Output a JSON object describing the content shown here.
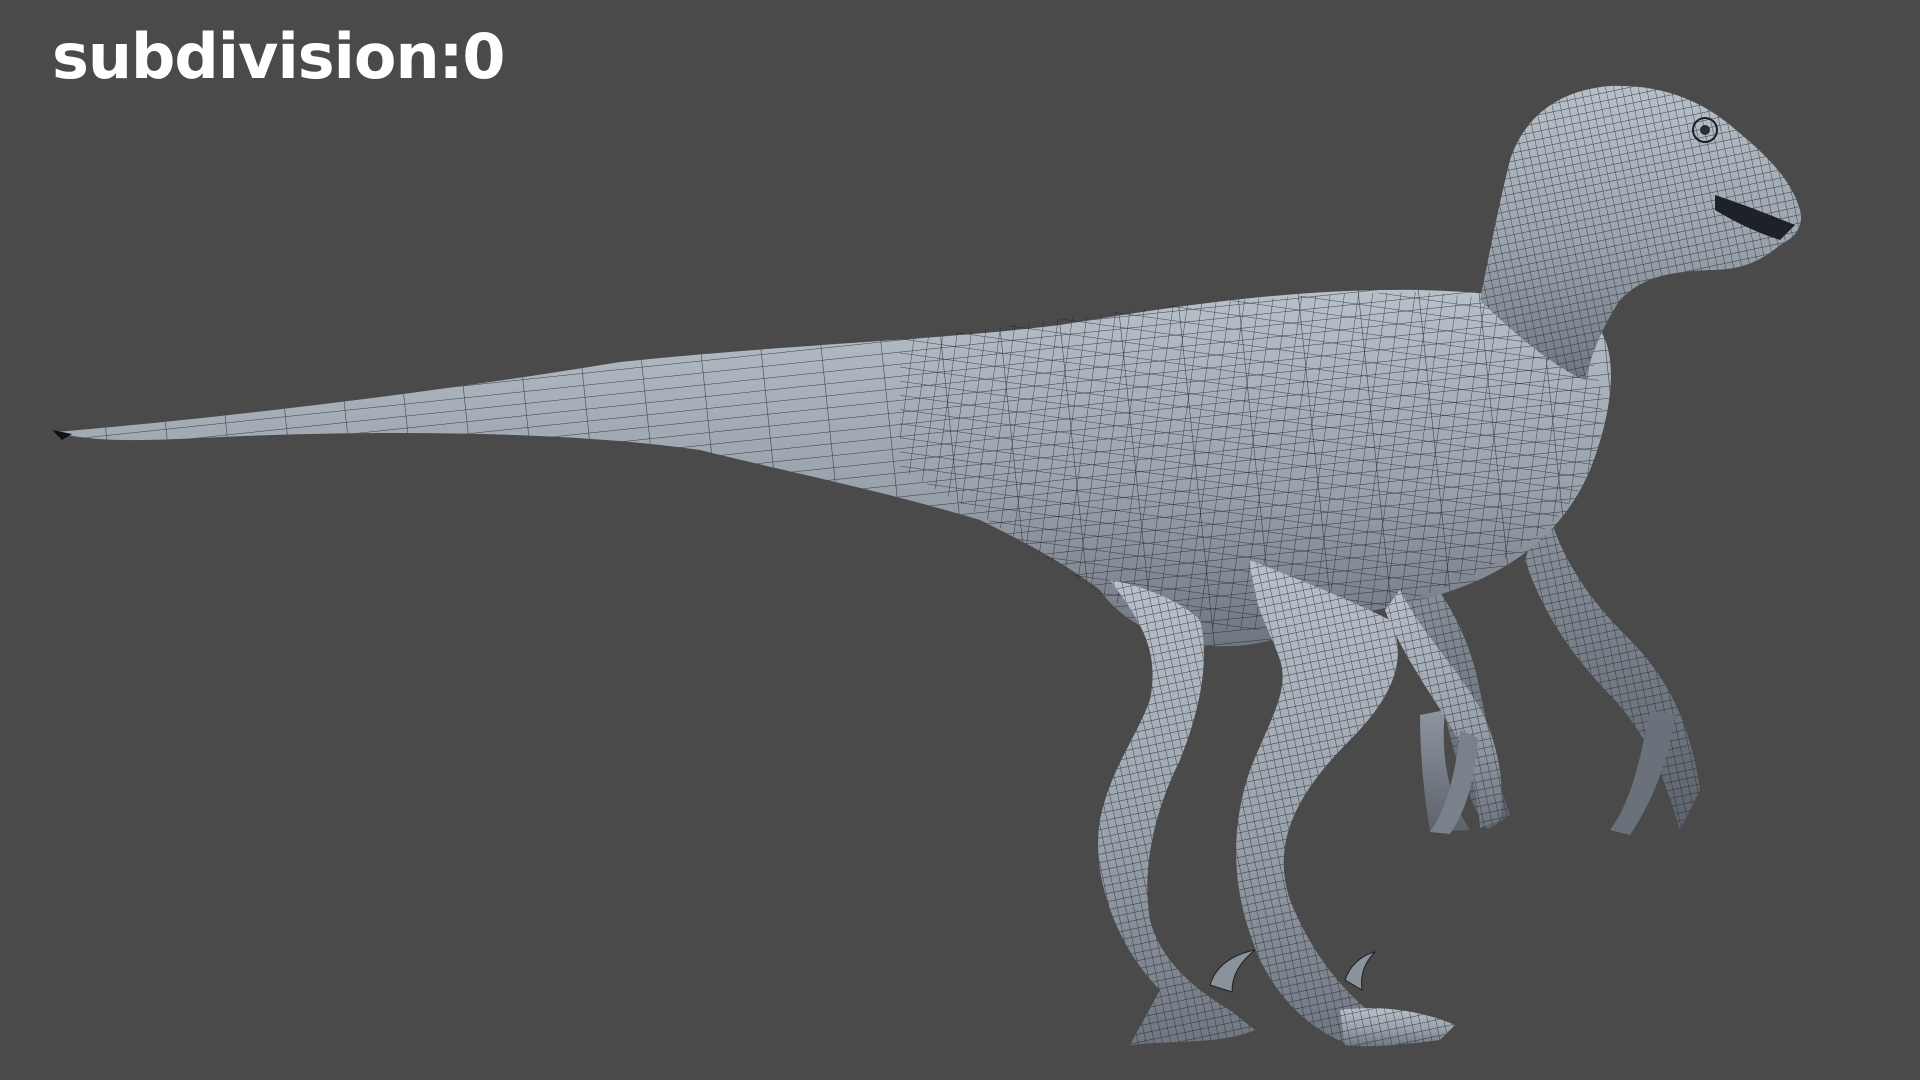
{
  "caption": "subdivision:0",
  "colors": {
    "background": "#4a4a4a",
    "model_skin": "#9ea6b0",
    "wireframe": "#1c2026",
    "caption_text": "#ffffff"
  },
  "scene": {
    "subject": "velociraptor-wireframe-model"
  }
}
